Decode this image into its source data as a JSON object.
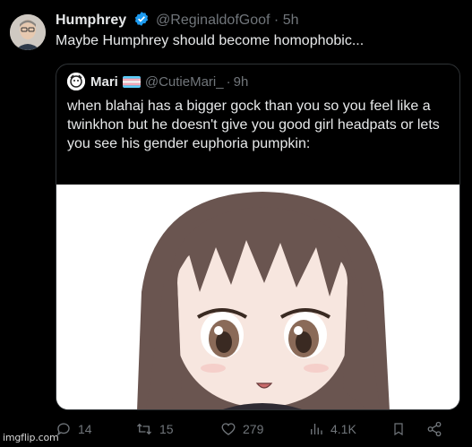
{
  "tweet": {
    "author_name": "Humphrey",
    "handle": "@ReginaldofGoof",
    "separator": "·",
    "time": "5h",
    "text": "Maybe Humphrey should become homophobic..."
  },
  "quote": {
    "author_name": "Mari",
    "handle": "@CutieMari_",
    "separator": "·",
    "time": "9h",
    "text": "when blahaj has a bigger gock than you so you feel like a twinkhon but he doesn't give you good girl headpats or lets you see his gender euphoria pumpkin:"
  },
  "actions": {
    "replies": "14",
    "retweets": "15",
    "likes": "279",
    "views": "4.1K"
  },
  "watermark": "imgflip.com",
  "colors": {
    "background": "#000000",
    "text": "#e7e9ea",
    "muted": "#71767b",
    "verified": "#1d9bf0",
    "border": "#2f3336"
  },
  "icons": [
    "verified-badge-icon",
    "reply-icon",
    "retweet-icon",
    "like-icon",
    "views-icon",
    "bookmark-icon",
    "share-icon",
    "trans-flag-icon"
  ]
}
